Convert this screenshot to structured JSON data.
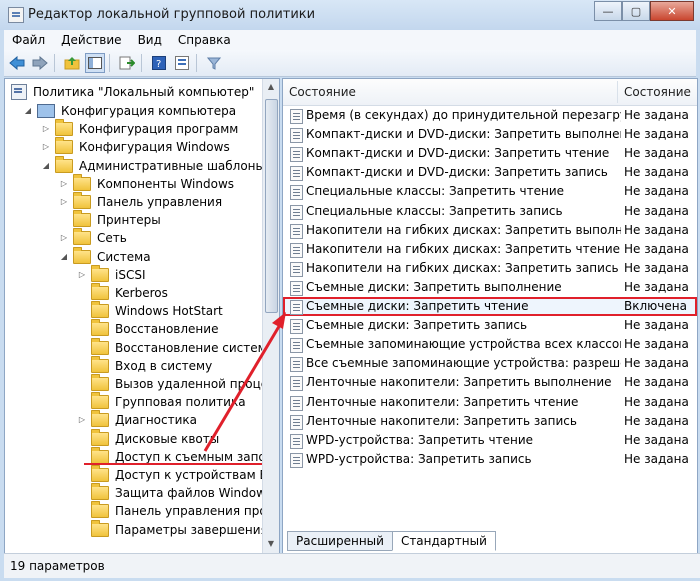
{
  "window": {
    "title": "Редактор локальной групповой политики"
  },
  "menu": [
    "Файл",
    "Действие",
    "Вид",
    "Справка"
  ],
  "toolbar": {
    "buttons": [
      "back-icon",
      "forward-icon",
      "up-folder-icon",
      "show-tree-icon",
      "export-icon",
      "help-icon",
      "properties-icon",
      "filter-icon"
    ]
  },
  "tree": {
    "root": "Политика \"Локальный компьютер\"",
    "items": [
      {
        "label": "Конфигурация компьютера",
        "level": 1,
        "expander": "open"
      },
      {
        "label": "Конфигурация программ",
        "level": 2,
        "expander": "closed"
      },
      {
        "label": "Конфигурация Windows",
        "level": 2,
        "expander": "closed"
      },
      {
        "label": "Административные шаблоны",
        "level": 2,
        "expander": "open"
      },
      {
        "label": "Компоненты Windows",
        "level": 3,
        "expander": "closed"
      },
      {
        "label": "Панель управления",
        "level": 3,
        "expander": "closed"
      },
      {
        "label": "Принтеры",
        "level": 3,
        "expander": "none"
      },
      {
        "label": "Сеть",
        "level": 3,
        "expander": "closed"
      },
      {
        "label": "Система",
        "level": 3,
        "expander": "open"
      },
      {
        "label": "iSCSI",
        "level": 4,
        "expander": "closed"
      },
      {
        "label": "Kerberos",
        "level": 4,
        "expander": "none"
      },
      {
        "label": "Windows HotStart",
        "level": 4,
        "expander": "none"
      },
      {
        "label": "Восстановление",
        "level": 4,
        "expander": "none"
      },
      {
        "label": "Восстановление системы",
        "level": 4,
        "expander": "none"
      },
      {
        "label": "Вход в систему",
        "level": 4,
        "expander": "none"
      },
      {
        "label": "Вызов удаленной процедуры",
        "level": 4,
        "expander": "none"
      },
      {
        "label": "Групповая политика",
        "level": 4,
        "expander": "none"
      },
      {
        "label": "Диагностика",
        "level": 4,
        "expander": "closed"
      },
      {
        "label": "Дисковые квоты",
        "level": 4,
        "expander": "none"
      },
      {
        "label": "Доступ к съемным запоминающим устройствам",
        "level": 4,
        "expander": "none"
      },
      {
        "label": "Доступ к устройствам Enhanced Storage",
        "level": 4,
        "expander": "none"
      },
      {
        "label": "Защита файлов Windows",
        "level": 4,
        "expander": "none"
      },
      {
        "label": "Панель управления производительностью",
        "level": 4,
        "expander": "none"
      },
      {
        "label": "Параметры завершения работы",
        "level": 4,
        "expander": "none"
      }
    ]
  },
  "list": {
    "header_name": "Состояние",
    "header_state": "Состояние",
    "rows": [
      {
        "name": "Время (в секундах) до принудительной перезагрузки",
        "state": "Не задана"
      },
      {
        "name": "Компакт-диски и DVD-диски: Запретить выполнение",
        "state": "Не задана"
      },
      {
        "name": "Компакт-диски и DVD-диски: Запретить чтение",
        "state": "Не задана"
      },
      {
        "name": "Компакт-диски и DVD-диски: Запретить запись",
        "state": "Не задана"
      },
      {
        "name": "Специальные классы: Запретить чтение",
        "state": "Не задана"
      },
      {
        "name": "Специальные классы: Запретить запись",
        "state": "Не задана"
      },
      {
        "name": "Накопители на гибких дисках: Запретить выполнение",
        "state": "Не задана"
      },
      {
        "name": "Накопители на гибких дисках: Запретить чтение",
        "state": "Не задана"
      },
      {
        "name": "Накопители на гибких дисках: Запретить запись",
        "state": "Не задана"
      },
      {
        "name": "Съемные диски: Запретить выполнение",
        "state": "Не задана"
      },
      {
        "name": "Съемные диски: Запретить чтение",
        "state": "Включена"
      },
      {
        "name": "Съемные диски: Запретить запись",
        "state": "Не задана"
      },
      {
        "name": "Съемные запоминающие устройства всех классов: Запретить весь доступ",
        "state": "Не задана"
      },
      {
        "name": "Все съемные запоминающие устройства: разрешение прямого доступа",
        "state": "Не задана"
      },
      {
        "name": "Ленточные накопители: Запретить выполнение",
        "state": "Не задана"
      },
      {
        "name": "Ленточные накопители: Запретить чтение",
        "state": "Не задана"
      },
      {
        "name": "Ленточные накопители: Запретить запись",
        "state": "Не задана"
      },
      {
        "name": "WPD-устройства: Запретить чтение",
        "state": "Не задана"
      },
      {
        "name": "WPD-устройства: Запретить запись",
        "state": "Не задана"
      }
    ]
  },
  "tabs": [
    "Расширенный",
    "Стандартный"
  ],
  "status": "19 параметров",
  "colors": {
    "highlight": "#e0202b"
  }
}
